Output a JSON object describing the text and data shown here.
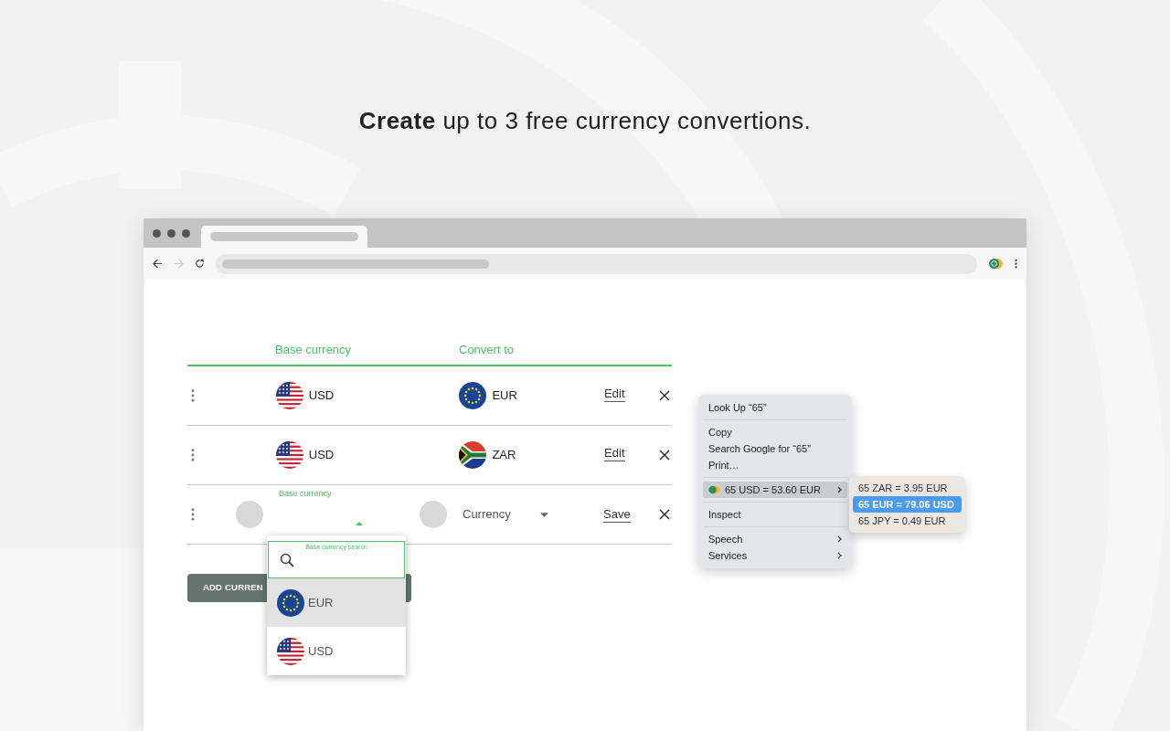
{
  "headline": "**Create** up to 3 free currency convertions.",
  "table": {
    "columns": [
      "Base currency",
      "Convert to"
    ],
    "rows": [
      {
        "kind": "saved",
        "base": {
          "code": "USD",
          "kind": "us"
        },
        "target": {
          "code": "EUR",
          "kind": "eu"
        },
        "action": "Edit"
      },
      {
        "kind": "saved",
        "base": {
          "code": "USD",
          "kind": "us"
        },
        "target": {
          "code": "ZAR",
          "kind": "za"
        },
        "action": "Edit"
      },
      {
        "kind": "editing",
        "base_label": "Base currency",
        "target_placeholder": "Currency",
        "action": "Save"
      }
    ]
  },
  "add_button": "ADD CURREN",
  "dropdown": {
    "search_label": "Base currency search",
    "options": [
      {
        "code": "EUR",
        "kind": "eu",
        "selected": true
      },
      {
        "code": "USD",
        "kind": "us",
        "selected": false
      }
    ]
  },
  "context_menu": {
    "groups": [
      [
        {
          "label": "Look Up “65”",
          "kind": "plain",
          "submenu": false,
          "selected": false
        }
      ],
      [
        {
          "label": "Copy",
          "kind": "plain",
          "submenu": false,
          "selected": false
        },
        {
          "label": "Search Google for “65”",
          "kind": "plain",
          "submenu": false,
          "selected": false
        },
        {
          "label": "Print…",
          "kind": "plain",
          "submenu": false,
          "selected": false
        }
      ],
      [
        {
          "label": "65 USD = 53.60 EUR",
          "kind": "extension",
          "submenu": true,
          "selected": true
        }
      ],
      [
        {
          "label": "Inspect",
          "kind": "plain",
          "submenu": false,
          "selected": false
        }
      ],
      [
        {
          "label": "Speech",
          "kind": "plain",
          "submenu": true,
          "selected": false
        },
        {
          "label": "Services",
          "kind": "plain",
          "submenu": true,
          "selected": false
        }
      ]
    ],
    "submenu": [
      {
        "label": "65 ZAR = 3.95 EUR",
        "selected": false
      },
      {
        "label": "65 EUR = 79.06 USD",
        "selected": true
      },
      {
        "label": "65 JPY = 0.49 EUR",
        "selected": false
      }
    ]
  }
}
